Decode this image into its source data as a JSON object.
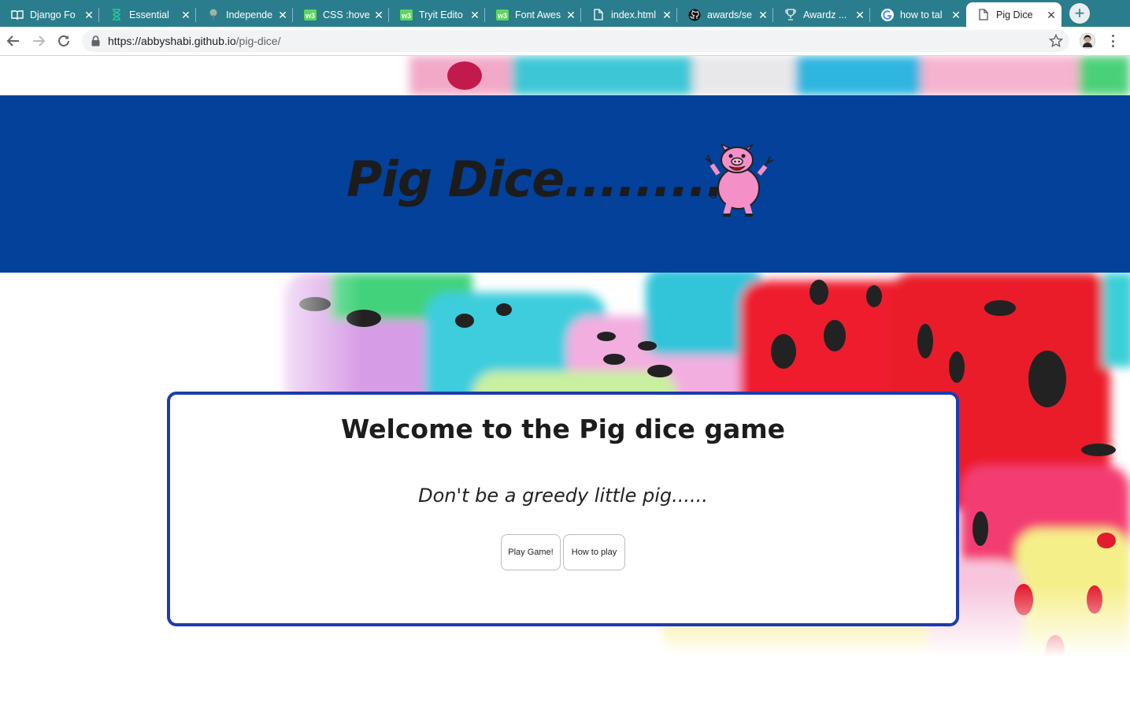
{
  "browser": {
    "tabs": [
      {
        "title": "Django Fo",
        "icon": "book-icon"
      },
      {
        "title": "Essential",
        "icon": "hourglass-icon"
      },
      {
        "title": "Independe",
        "icon": "tree-icon"
      },
      {
        "title": "CSS :hove",
        "icon": "w3schools-icon"
      },
      {
        "title": "Tryit Edito",
        "icon": "w3schools-icon"
      },
      {
        "title": "Font Awes",
        "icon": "w3schools-icon"
      },
      {
        "title": "index.html",
        "icon": "document-icon"
      },
      {
        "title": "awards/se",
        "icon": "github-icon"
      },
      {
        "title": "Awardz ...",
        "icon": "trophy-icon"
      },
      {
        "title": "how to tal",
        "icon": "google-icon"
      },
      {
        "title": "Pig Dice",
        "icon": "document-icon",
        "active": true
      }
    ],
    "url_host": "https://abbyshabi.github.io",
    "url_path": "/pig-dice/",
    "accent_color": "#2a7d8c"
  },
  "header": {
    "title": "Pig Dice..........",
    "background_color": "#03419a"
  },
  "card": {
    "title": "Welcome to the Pig dice game",
    "tagline": "Don't be a greedy little pig......",
    "play_button": "Play Game!",
    "howto_button": "How to play",
    "border_color": "#1d3bb0"
  }
}
